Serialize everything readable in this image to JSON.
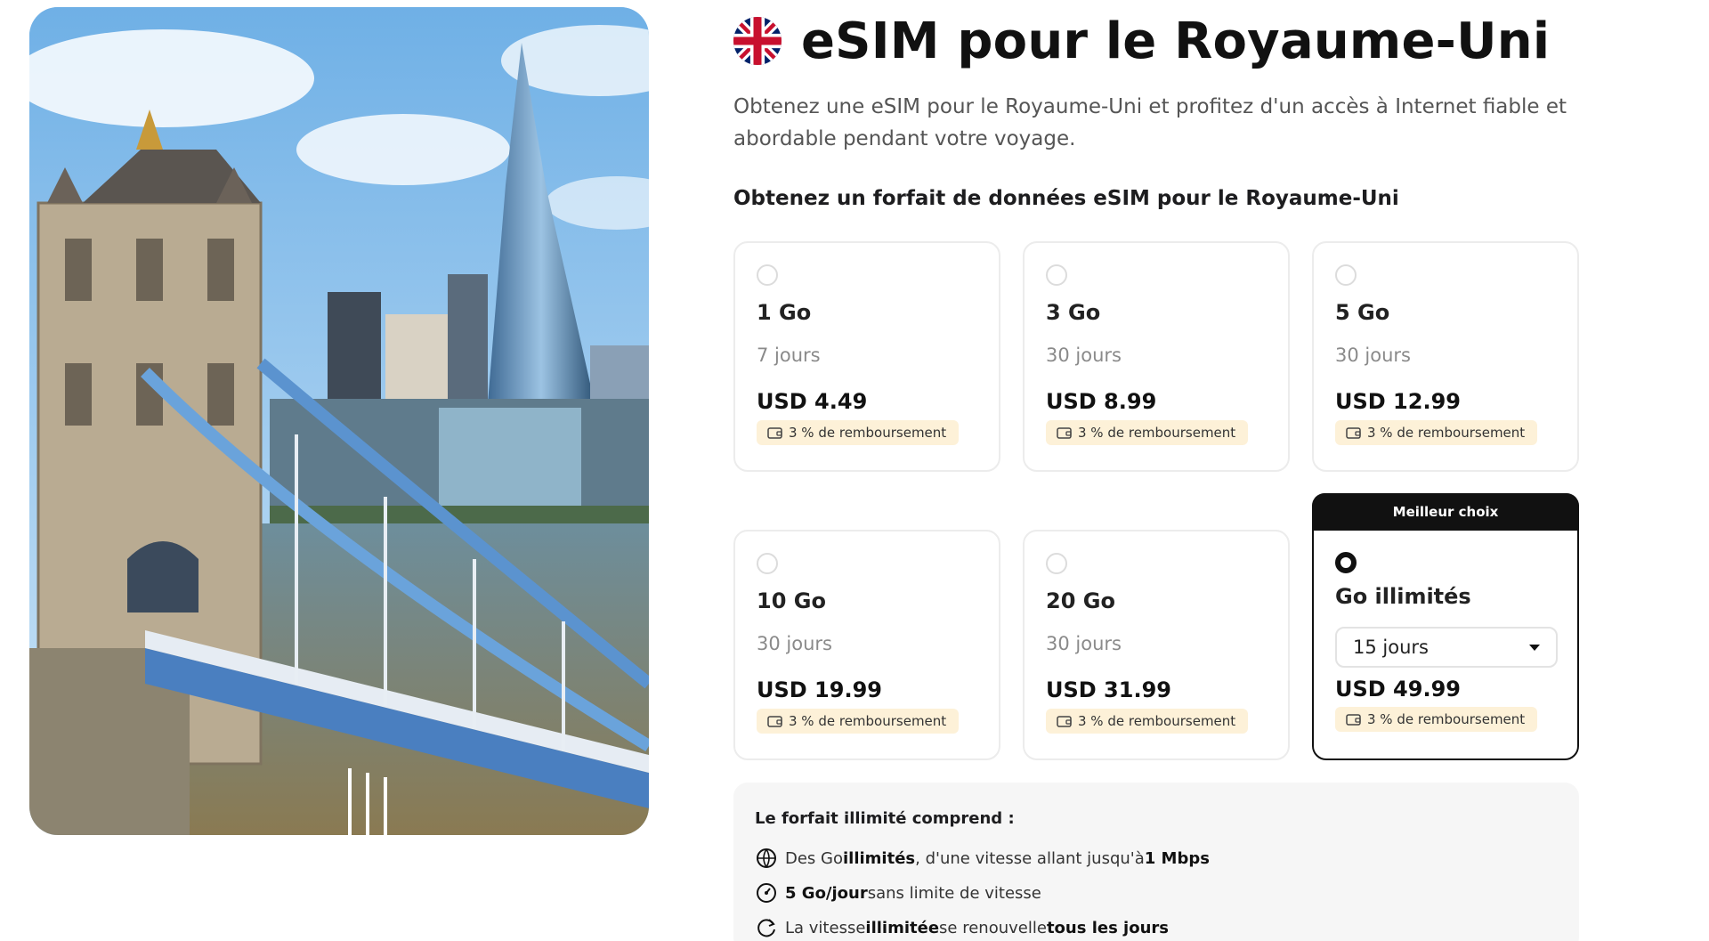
{
  "page": {
    "title": "eSIM pour le Royaume-Uni",
    "subtitle": "Obtenez une eSIM pour le Royaume-Uni et profitez d'un accès à Internet fiable et abordable pendant votre voyage.",
    "section_title": "Obtenez un forfait de données eSIM pour le Royaume-Uni",
    "flag_icon": "uk-flag-icon",
    "hero_image": "tower-bridge-shard-photo"
  },
  "plans": [
    {
      "size": "1 Go",
      "days": "7 jours",
      "price": "USD 4.49",
      "cashback": "3 % de remboursement",
      "selected": false
    },
    {
      "size": "3 Go",
      "days": "30 jours",
      "price": "USD 8.99",
      "cashback": "3 % de remboursement",
      "selected": false
    },
    {
      "size": "5 Go",
      "days": "30 jours",
      "price": "USD 12.99",
      "cashback": "3 % de remboursement",
      "selected": false
    },
    {
      "size": "10 Go",
      "days": "30 jours",
      "price": "USD 19.99",
      "cashback": "3 % de remboursement",
      "selected": false
    },
    {
      "size": "20 Go",
      "days": "30 jours",
      "price": "USD 31.99",
      "cashback": "3 % de remboursement",
      "selected": false
    },
    {
      "badge": "Meilleur choix",
      "size": "Go illimités",
      "duration_select": "15 jours",
      "price": "USD 49.99",
      "cashback": "3 % de remboursement",
      "selected": true
    }
  ],
  "unlimited_info": {
    "title": "Le forfait illimité comprend :",
    "lines": [
      {
        "icon": "globe-speed-icon",
        "pre": "Des Go ",
        "bold1": "illimités",
        "mid": ", d'une vitesse allant jusqu'à ",
        "bold2": "1 Mbps",
        "post": ""
      },
      {
        "icon": "speedometer-icon",
        "pre": "",
        "bold1": "5 Go/jour",
        "mid": " sans limite de vitesse",
        "bold2": "",
        "post": ""
      },
      {
        "icon": "refresh-icon",
        "pre": "La vitesse ",
        "bold1": "illimitée",
        "mid": " se renouvelle ",
        "bold2": "tous les jours",
        "post": ""
      }
    ]
  },
  "colors": {
    "accent": "#111111",
    "cashback_bg": "#fdf1d8",
    "card_border": "#ececec",
    "info_bg": "#f6f6f6"
  }
}
